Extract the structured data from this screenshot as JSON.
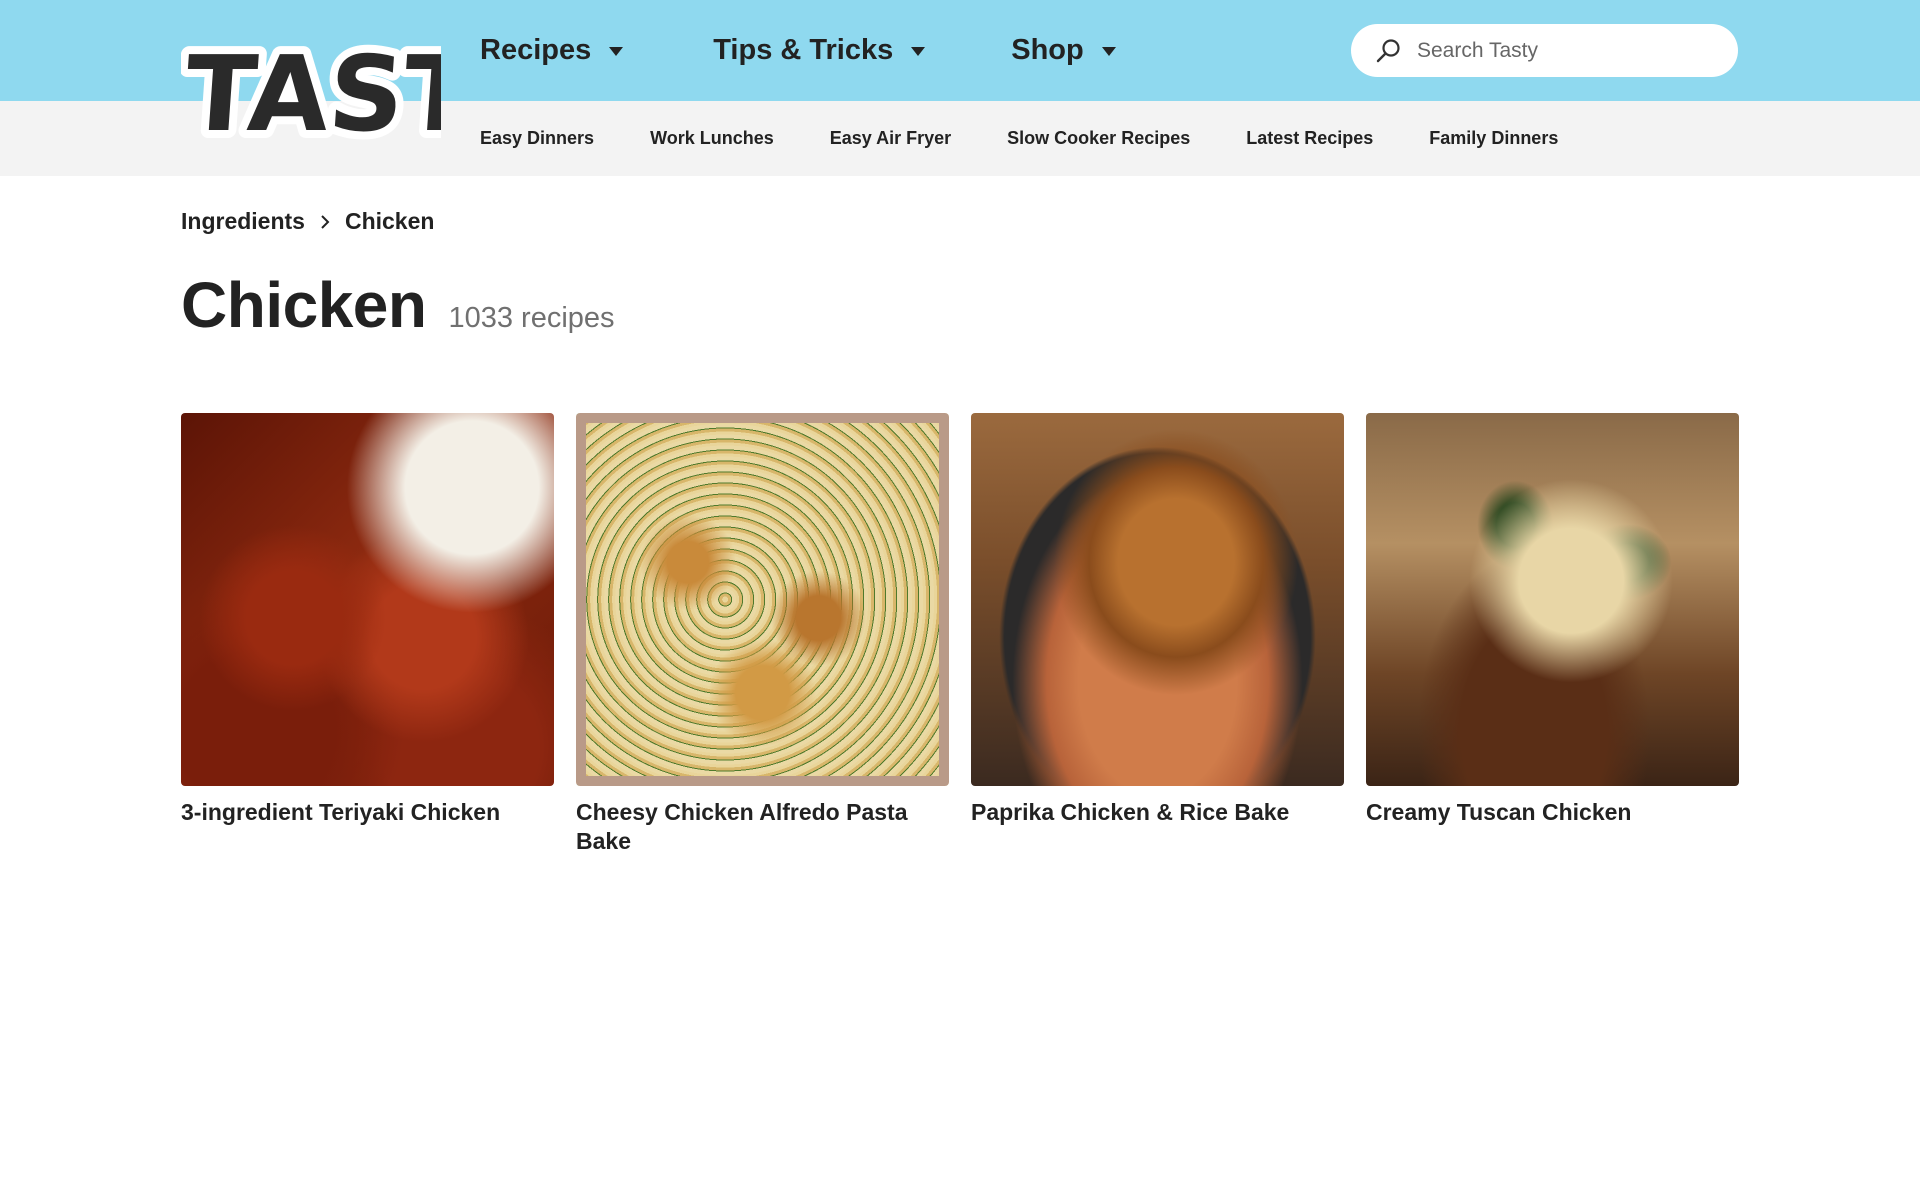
{
  "brand": {
    "logo_text": "TASTY",
    "header_color": "#8fd9ef"
  },
  "main_nav": [
    {
      "label": "Recipes"
    },
    {
      "label": "Tips & Tricks"
    },
    {
      "label": "Shop"
    }
  ],
  "search": {
    "placeholder": "Search Tasty",
    "icon": "search-icon"
  },
  "sub_nav": [
    {
      "label": "Easy Dinners"
    },
    {
      "label": "Work Lunches"
    },
    {
      "label": "Easy Air Fryer"
    },
    {
      "label": "Slow Cooker Recipes"
    },
    {
      "label": "Latest Recipes"
    },
    {
      "label": "Family Dinners"
    }
  ],
  "breadcrumb": {
    "parent": "Ingredients",
    "current": "Chicken",
    "separator_icon": "chevron-right-icon"
  },
  "page": {
    "title": "Chicken",
    "count": "1033 recipes"
  },
  "recipes": [
    {
      "title": "3-ingredient Teriyaki Chicken"
    },
    {
      "title": "Cheesy Chicken Alfredo Pasta Bake"
    },
    {
      "title": "Paprika Chicken & Rice Bake"
    },
    {
      "title": "Creamy Tuscan Chicken"
    }
  ]
}
